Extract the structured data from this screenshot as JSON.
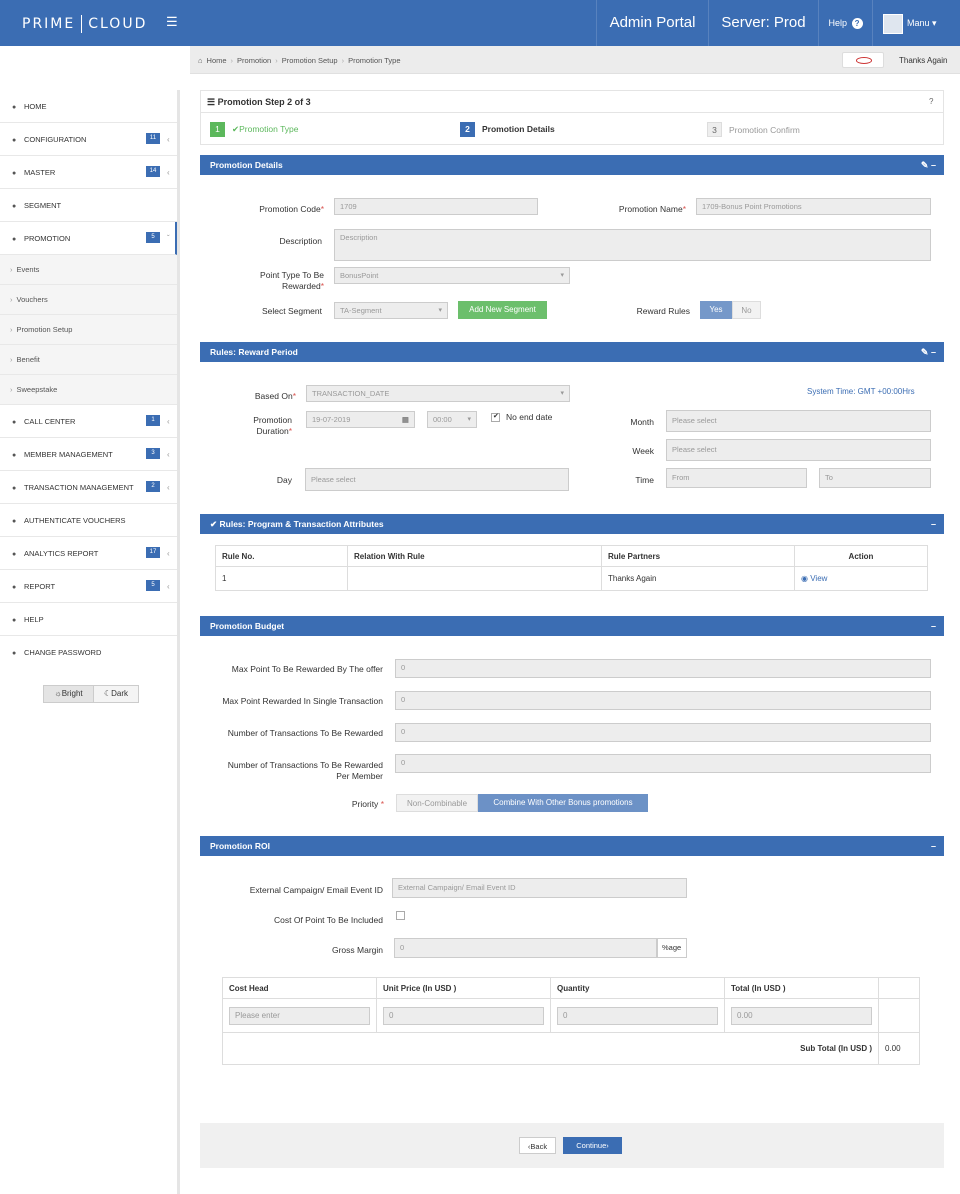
{
  "topbar": {
    "logo_left": "PRIME",
    "logo_right": "CLOUD",
    "menu_icon": "hamburger-icon",
    "portal": "Admin Portal",
    "server": "Server: Prod",
    "help": "Help",
    "user": "Manu"
  },
  "breadcrumb": {
    "items": [
      "Home",
      "Promotion",
      "Promotion Setup",
      "Promotion Type"
    ],
    "partner": "Thanks Again"
  },
  "sidebar": {
    "items": [
      {
        "label": "HOME"
      },
      {
        "label": "CONFIGURATION",
        "badge": "11"
      },
      {
        "label": "MASTER",
        "badge": "14"
      },
      {
        "label": "SEGMENT"
      },
      {
        "label": "PROMOTION",
        "badge": "5"
      },
      {
        "label": "CALL CENTER",
        "badge": "1"
      },
      {
        "label": "MEMBER MANAGEMENT",
        "badge": "3"
      },
      {
        "label": "TRANSACTION MANAGEMENT",
        "badge": "2"
      },
      {
        "label": "AUTHENTICATE VOUCHERS"
      },
      {
        "label": "ANALYTICS REPORT",
        "badge": "17"
      },
      {
        "label": "REPORT",
        "badge": "5"
      },
      {
        "label": "HELP"
      },
      {
        "label": "CHANGE PASSWORD"
      }
    ],
    "sub_items": [
      "Events",
      "Vouchers",
      "Promotion Setup",
      "Benefit",
      "Sweepstake"
    ],
    "theme_bright": "Bright",
    "theme_dark": "Dark"
  },
  "steps": {
    "title": "Promotion Step 2 of 3",
    "help": "?",
    "items": [
      {
        "num": "1",
        "label": "Promotion Type"
      },
      {
        "num": "2",
        "label": "Promotion Details"
      },
      {
        "num": "3",
        "label": "Promotion Confirm"
      }
    ]
  },
  "details": {
    "header": "Promotion Details",
    "code_label": "Promotion Code",
    "code_value": "1709",
    "name_label": "Promotion Name",
    "name_value": "1709-Bonus Point Promotions",
    "desc_label": "Description",
    "desc_placeholder": "Description",
    "point_type_label_1": "Point Type To Be",
    "point_type_label_2": "Rewarded",
    "point_type_value": "BonusPoint",
    "segment_label": "Select Segment",
    "segment_value": "TA-Segment",
    "add_segment": "Add New Segment",
    "reward_rules_label": "Reward Rules",
    "yes": "Yes",
    "no": "No"
  },
  "reward_period": {
    "header": "Rules: Reward Period",
    "based_on_label": "Based On",
    "based_on_value": "TRANSACTION_DATE",
    "system_time": "System Time: GMT +00:00Hrs",
    "duration_label_1": "Promotion",
    "duration_label_2": "Duration",
    "date_value": "19-07-2019",
    "time_value": "00:00",
    "no_end_date": "No end date",
    "month_label": "Month",
    "month_placeholder": "Please select",
    "week_label": "Week",
    "week_placeholder": "Please select",
    "day_label": "Day",
    "day_placeholder": "Please select",
    "time_label": "Time",
    "from_placeholder": "From",
    "to_placeholder": "To"
  },
  "attributes": {
    "header": "Rules: Program & Transaction Attributes",
    "columns": [
      "Rule No.",
      "Relation With Rule",
      "Rule Partners",
      "Action"
    ],
    "rows": [
      [
        "1",
        "",
        "Thanks Again",
        "View"
      ]
    ]
  },
  "budget": {
    "header": "Promotion Budget",
    "max_points_label": "Max Point To Be Rewarded By The offer",
    "max_single_label": "Max Point Rewarded In Single Transaction",
    "num_tx_label": "Number of Transactions To Be Rewarded",
    "num_tx_member_label_1": "Number of Transactions To Be Rewarded",
    "num_tx_member_label_2": "Per Member",
    "placeholder_zero": "0",
    "priority_label": "Priority",
    "priority_a": "Non-Combinable",
    "priority_b": "Combine With Other Bonus promotions"
  },
  "roi": {
    "header": "Promotion ROI",
    "campaign_label": "External Campaign/ Email Event ID",
    "campaign_placeholder": "External Campaign/ Email Event ID",
    "cost_included_label": "Cost Of Point To Be Included",
    "gross_margin_label": "Gross Margin",
    "gross_margin_value": "0",
    "gross_margin_unit": "%age",
    "columns": [
      "Cost Head",
      "Unit Price (In USD )",
      "Quantity",
      "Total (In USD )"
    ],
    "row_cost_head": "Please enter",
    "row_unit_price": "0",
    "row_quantity": "0",
    "row_total": "0.00",
    "subtotal_label": "Sub Total (In USD )",
    "subtotal_value": "0.00"
  },
  "footer": {
    "back": "Back",
    "continue": "Continue"
  }
}
